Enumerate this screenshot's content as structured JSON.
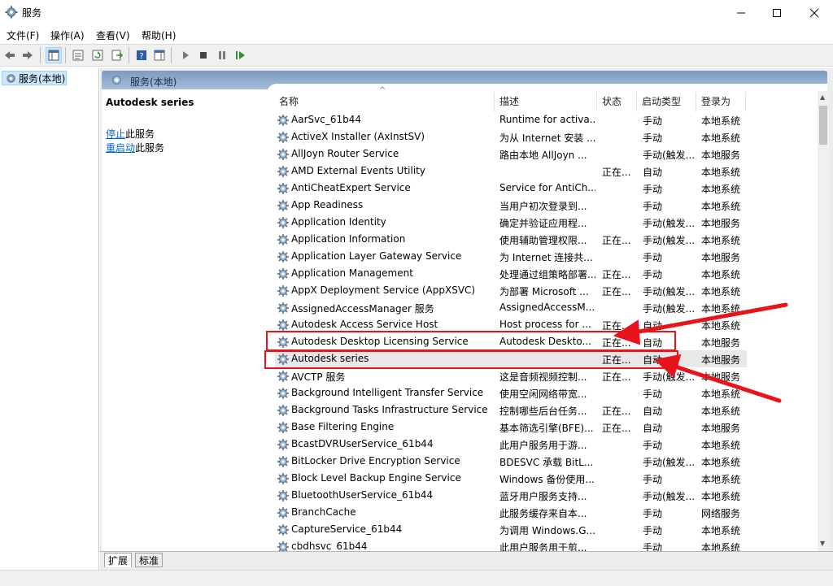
{
  "window": {
    "title": "服务"
  },
  "menu": [
    "文件(F)",
    "操作(A)",
    "查看(V)",
    "帮助(H)"
  ],
  "tree": {
    "root_label": "服务(本地)"
  },
  "panel": {
    "title": "服务(本地)"
  },
  "description": {
    "service_name": "Autodesk series",
    "stop_link": "停止",
    "stop_suffix": "此服务",
    "restart_link": "重启动",
    "restart_suffix": "此服务"
  },
  "columns": [
    "名称",
    "描述",
    "状态",
    "启动类型",
    "登录为"
  ],
  "rows": [
    {
      "name": "AarSvc_61b44",
      "desc": "Runtime for activa...",
      "status": "",
      "start": "手动",
      "logon": "本地系统"
    },
    {
      "name": "ActiveX Installer (AxInstSV)",
      "desc": "为从 Internet 安装 ...",
      "status": "",
      "start": "手动",
      "logon": "本地系统"
    },
    {
      "name": "AllJoyn Router Service",
      "desc": "路由本地 AllJoyn ...",
      "status": "",
      "start": "手动(触发...",
      "logon": "本地服务"
    },
    {
      "name": "AMD External Events Utility",
      "desc": "",
      "status": "正在...",
      "start": "自动",
      "logon": "本地系统"
    },
    {
      "name": "AntiCheatExpert Service",
      "desc": "Service for AntiCh...",
      "status": "",
      "start": "手动",
      "logon": "本地系统"
    },
    {
      "name": "App Readiness",
      "desc": "当用户初次登录到...",
      "status": "",
      "start": "手动",
      "logon": "本地系统"
    },
    {
      "name": "Application Identity",
      "desc": "确定并验证应用程...",
      "status": "",
      "start": "手动(触发...",
      "logon": "本地服务"
    },
    {
      "name": "Application Information",
      "desc": "使用辅助管理权限...",
      "status": "正在...",
      "start": "手动(触发...",
      "logon": "本地系统"
    },
    {
      "name": "Application Layer Gateway Service",
      "desc": "为 Internet 连接共...",
      "status": "",
      "start": "手动",
      "logon": "本地服务"
    },
    {
      "name": "Application Management",
      "desc": "处理通过组策略部署...",
      "status": "正在...",
      "start": "手动",
      "logon": "本地系统"
    },
    {
      "name": "AppX Deployment Service (AppXSVC)",
      "desc": "为部署 Microsoft ...",
      "status": "正在...",
      "start": "手动(触发...",
      "logon": "本地系统"
    },
    {
      "name": "AssignedAccessManager 服务",
      "desc": "AssignedAccessM...",
      "status": "",
      "start": "手动(触发...",
      "logon": "本地系统"
    },
    {
      "name": "Autodesk Access Service Host",
      "desc": "Host process for ...",
      "status": "正在...",
      "start": "自动",
      "logon": "本地系统"
    },
    {
      "name": "Autodesk Desktop Licensing Service",
      "desc": "Autodesk Deskto...",
      "status": "正在...",
      "start": "自动",
      "logon": "本地服务"
    },
    {
      "name": "Autodesk series",
      "desc": "",
      "status": "正在...",
      "start": "自动",
      "logon": "本地服务"
    },
    {
      "name": "AVCTP 服务",
      "desc": "这是音频视频控制...",
      "status": "正在...",
      "start": "手动(触发...",
      "logon": "本地服务"
    },
    {
      "name": "Background Intelligent Transfer Service",
      "desc": "使用空闲网络带宽...",
      "status": "",
      "start": "手动",
      "logon": "本地系统"
    },
    {
      "name": "Background Tasks Infrastructure Service",
      "desc": "控制哪些后台任务...",
      "status": "正在...",
      "start": "自动",
      "logon": "本地系统"
    },
    {
      "name": "Base Filtering Engine",
      "desc": "基本筛选引擎(BFE)...",
      "status": "正在...",
      "start": "自动",
      "logon": "本地服务"
    },
    {
      "name": "BcastDVRUserService_61b44",
      "desc": "此用户服务用于游...",
      "status": "",
      "start": "手动",
      "logon": "本地系统"
    },
    {
      "name": "BitLocker Drive Encryption Service",
      "desc": "BDESVC 承载 BitL...",
      "status": "",
      "start": "手动(触发...",
      "logon": "本地系统"
    },
    {
      "name": "Block Level Backup Engine Service",
      "desc": "Windows 备份使用...",
      "status": "",
      "start": "手动",
      "logon": "本地系统"
    },
    {
      "name": "BluetoothUserService_61b44",
      "desc": "蓝牙用户服务支持...",
      "status": "",
      "start": "手动(触发...",
      "logon": "本地系统"
    },
    {
      "name": "BranchCache",
      "desc": "此服务缓存来自本...",
      "status": "",
      "start": "手动",
      "logon": "网络服务"
    },
    {
      "name": "CaptureService_61b44",
      "desc": "为调用 Windows.G...",
      "status": "",
      "start": "手动",
      "logon": "本地系统"
    },
    {
      "name": "cbdhsvc_61b44",
      "desc": "此用户服务用于剪...",
      "status": "",
      "start": "手动",
      "logon": "本地系统"
    }
  ],
  "tabs": {
    "extended": "扩展",
    "standard": "标准"
  },
  "colors": {
    "highlight": "#e8141b",
    "link": "#0066cc",
    "selection": "#cce8ff"
  }
}
